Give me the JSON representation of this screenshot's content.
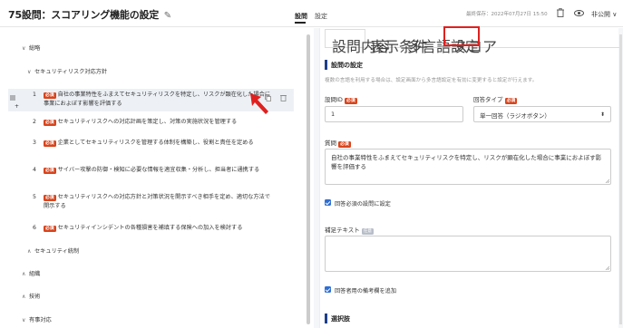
{
  "header": {
    "title": "75設問：スコアリング機能の設定",
    "tabs": [
      {
        "label": "設問"
      },
      {
        "label": "設定"
      }
    ],
    "last_updated": "最終保存：2022年07月27日 15:50",
    "status": "非公開"
  },
  "tree": {
    "nodes": [
      {
        "label": "総略",
        "chevron": "∨"
      },
      {
        "label": "セキュリティリスク対応方針",
        "chevron": "∨"
      }
    ],
    "required_badge": "必須",
    "items": [
      {
        "num": "1",
        "text": "自社の事業特性をふまえてセキュリティリスクを特定し、リスクが顕在化した場合に事業におよぼす影響を評価する"
      },
      {
        "num": "2",
        "text": "セキュリティリスクへの対応計画を策定し、対策の実施状況を管理する"
      },
      {
        "num": "3",
        "text": "企業としてセキュリティリスクを管理する体制を構築し、役割と責任を定める"
      },
      {
        "num": "4",
        "text": "サイバー攻撃の防御・検知に必要な情報を適宜収集・分析し、担当者に通携する"
      },
      {
        "num": "5",
        "text": "セキュリティリスクへの対応方針と対策状況を開示すべき相手を定め、適切な方法で開示する"
      },
      {
        "num": "6",
        "text": "セキュリティインシデントの各種損害を補填する保険への加入を検討する"
      }
    ],
    "groups": [
      {
        "label": "セキュリティ統制",
        "chevron": "∧"
      },
      {
        "label": "組織",
        "chevron": "∧"
      },
      {
        "label": "技術",
        "chevron": "∧"
      },
      {
        "label": "有事対応",
        "chevron": "∨"
      }
    ]
  },
  "panel": {
    "tabs": [
      {
        "label": "設問内容"
      },
      {
        "label": "表示条件"
      },
      {
        "label": "多言語設定"
      },
      {
        "label": "スコア"
      }
    ],
    "section_title": "設問の設定",
    "description": "複数の言語を利用する場合は、設定画面から多言語設定を有効に変更すると設定が行えます。",
    "question_id_label": "設問ID",
    "question_id_value": "1",
    "answer_type_label": "回答タイプ",
    "answer_type_value": "単一回答（ラジオボタン）",
    "question_label": "質問",
    "question_text": "自社の事業特性をふまえてセキュリティリスクを特定し、リスクが顕在化した場合に事業におよぼす影響を評価する",
    "required_checkbox": "回答必須の設問に設定",
    "supplement_label": "補足テキスト",
    "optional_badge": "任意",
    "remarks_checkbox": "回答者用の備考欄を追加",
    "choices_title": "選択肢"
  },
  "colors": {
    "required": "#d9441c",
    "highlight_box": "#e0201f",
    "checkbox": "#2f6fd4",
    "section_bar": "#1f3f8a"
  }
}
